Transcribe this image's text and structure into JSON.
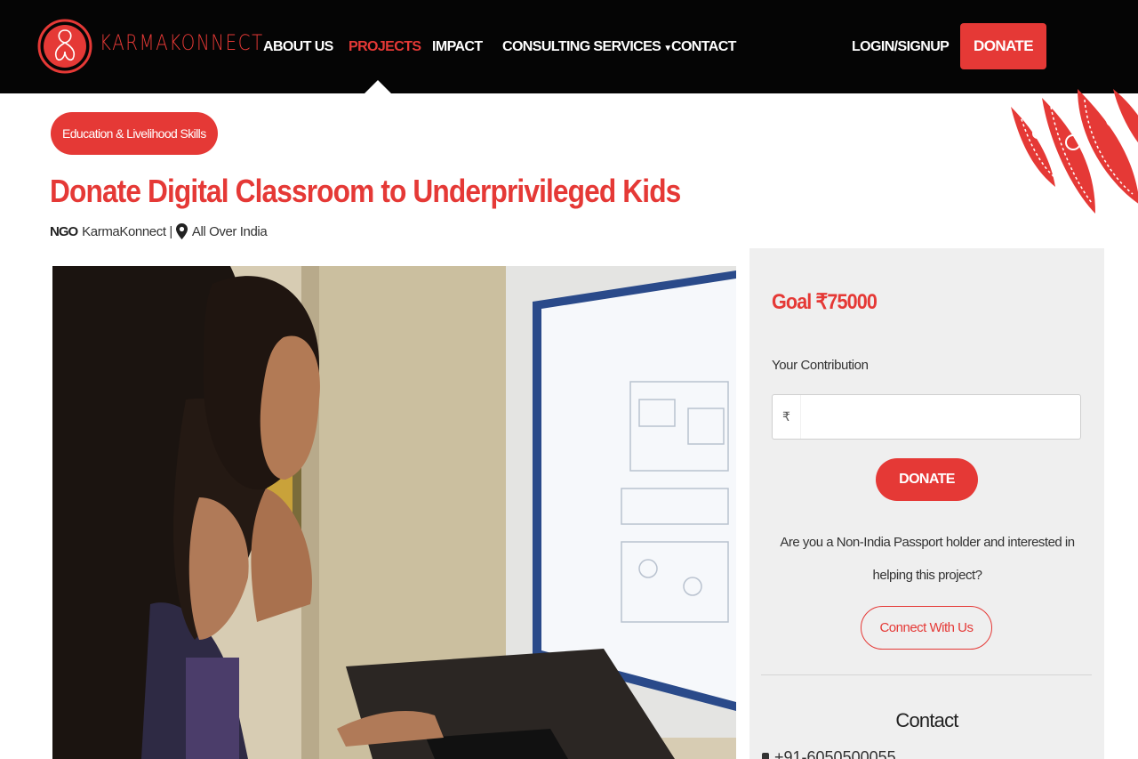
{
  "header": {
    "logo_text": "KARMAKONNECT",
    "nav": [
      {
        "label": "ABOUT US",
        "active": false
      },
      {
        "label": "PROJECTS",
        "active": true
      },
      {
        "label": "IMPACT",
        "active": false
      },
      {
        "label": "CONSULTING SERVICES",
        "active": false,
        "has_dropdown": true
      },
      {
        "label": "CONTACT",
        "active": false
      }
    ],
    "login_label": "LOGIN/SIGNUP",
    "donate_label": "DONATE"
  },
  "project": {
    "category": "Education & Livelihood Skills",
    "title": "Donate Digital Classroom to Underprivileged Kids",
    "ngo_tag": "NGO",
    "ngo_name": "KarmaKonnect |",
    "location": "All Over India"
  },
  "donation": {
    "goal_label": "Goal",
    "currency_symbol": "₹",
    "goal_amount": "75000",
    "contribution_label": "Your Contribution",
    "contribution_value": "",
    "donate_label": "DONATE",
    "nonindia_text": "Are you a Non-India Passport holder and interested in helping this project?",
    "connect_label": "Connect With Us",
    "contact_title": "Contact",
    "phone": "+91-6050500055"
  },
  "colors": {
    "accent": "#e53936",
    "header_bg": "#050505",
    "panel_bg": "#efefef"
  }
}
